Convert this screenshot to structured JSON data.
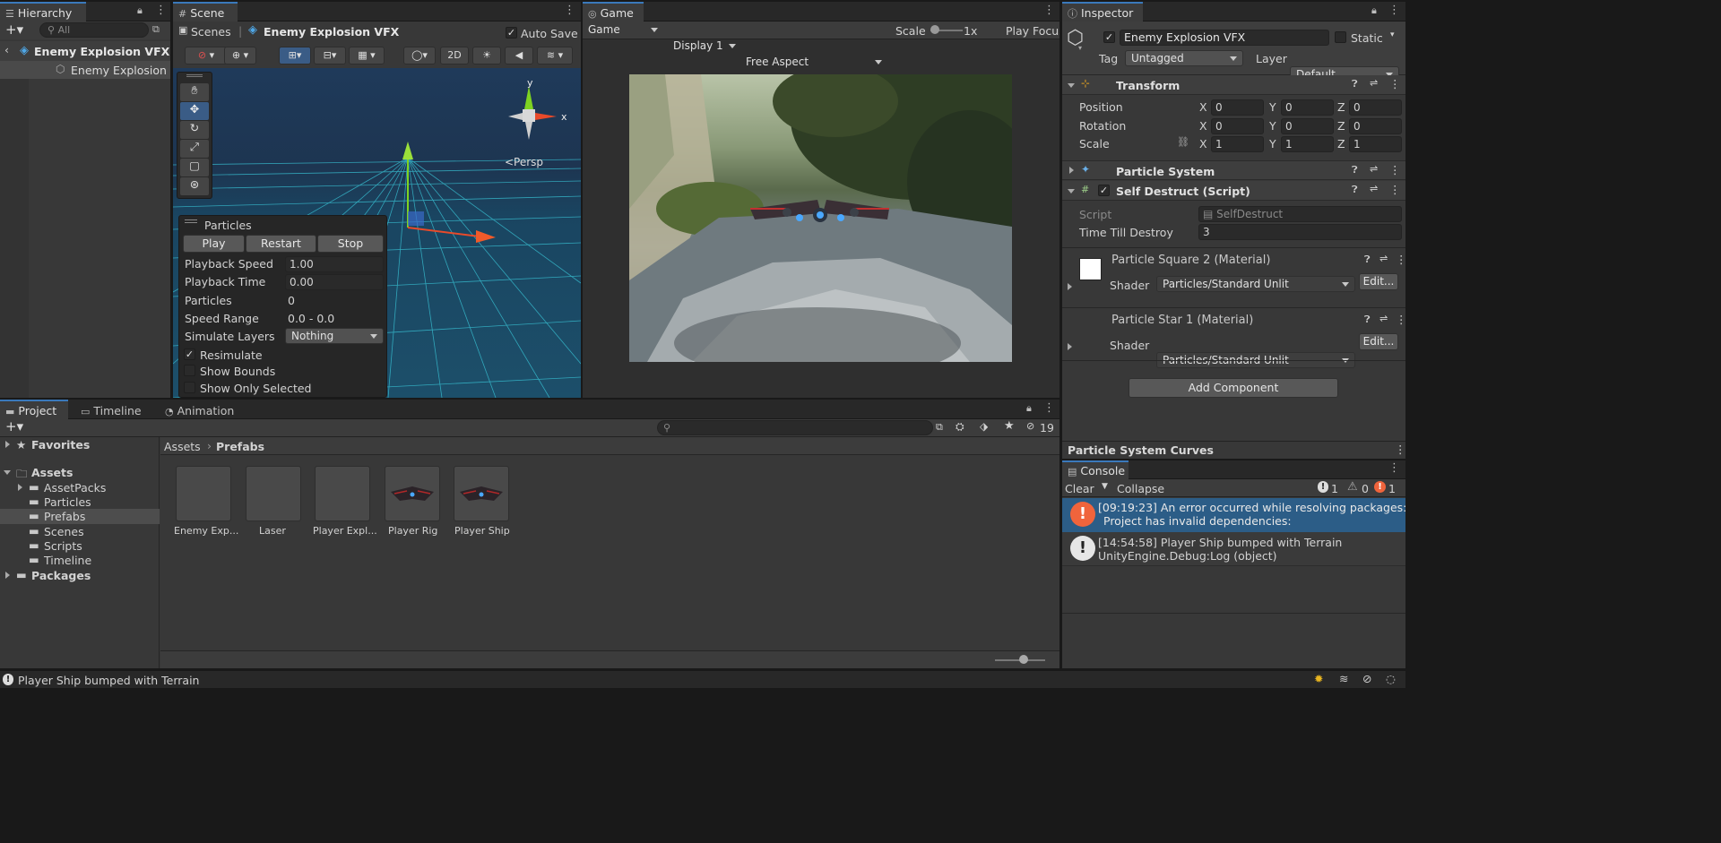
{
  "hierarchy": {
    "tab": "Hierarchy",
    "search_placeholder": "All",
    "scene_name": "Enemy Explosion VFX",
    "child_name": "Enemy Explosion V"
  },
  "scene": {
    "tab": "Scene",
    "breadcrumb_root": "Scenes",
    "breadcrumb_prefab": "Enemy Explosion VFX",
    "auto_save_label": "Auto Save",
    "auto_save_checked": true,
    "btn_2d": "2D",
    "gizmo_x": "x",
    "gizmo_y": "y",
    "persp_label": "<Persp",
    "particles": {
      "title": "Particles",
      "play": "Play",
      "restart": "Restart",
      "stop": "Stop",
      "playback_speed_label": "Playback Speed",
      "playback_speed": "1.00",
      "playback_time_label": "Playback Time",
      "playback_time": "0.00",
      "particles_label": "Particles",
      "particles_count": "0",
      "speed_range_label": "Speed Range",
      "speed_range": "0.0 - 0.0",
      "simulate_layers_label": "Simulate Layers",
      "simulate_layers": "Nothing",
      "resimulate": "Resimulate",
      "show_bounds": "Show Bounds",
      "show_only_selected": "Show Only Selected"
    }
  },
  "game": {
    "tab": "Game",
    "mode": "Game",
    "display": "Display 1",
    "aspect": "Free Aspect",
    "scale_label": "Scale",
    "scale_value": "1x",
    "play_focus": "Play Focus"
  },
  "inspector": {
    "tab": "Inspector",
    "object_name": "Enemy Explosion VFX",
    "static_label": "Static",
    "tag_label": "Tag",
    "tag_value": "Untagged",
    "layer_label": "Layer",
    "layer_value": "Default",
    "transform": {
      "title": "Transform",
      "position_label": "Position",
      "rotation_label": "Rotation",
      "scale_label": "Scale",
      "position": [
        "0",
        "0",
        "0"
      ],
      "rotation": [
        "0",
        "0",
        "0"
      ],
      "scale": [
        "1",
        "1",
        "1"
      ],
      "axis_x": "X",
      "axis_y": "Y",
      "axis_z": "Z"
    },
    "particle_system_title": "Particle System",
    "self_destruct": {
      "title": "Self Destruct (Script)",
      "script_label": "Script",
      "script_value": "SelfDestruct",
      "time_label": "Time Till Destroy",
      "time_value": "3"
    },
    "materials": [
      {
        "name": "Particle Square 2 (Material)",
        "shader_label": "Shader",
        "shader": "Particles/Standard Unlit",
        "edit": "Edit..."
      },
      {
        "name": "Particle Star 1 (Material)",
        "shader_label": "Shader",
        "shader": "Particles/Standard Unlit",
        "edit": "Edit..."
      }
    ],
    "add_component": "Add Component",
    "curves_title": "Particle System Curves"
  },
  "console": {
    "tab": "Console",
    "clear": "Clear",
    "collapse": "Collapse",
    "info_count": "1",
    "warn_count": "0",
    "error_count": "1",
    "entries": [
      {
        "time": "[09:19:23] An error occurred while resolving packages:",
        "line2": "Project has invalid dependencies:",
        "type": "error"
      },
      {
        "time": "[14:54:58] Player Ship bumped with Terrain",
        "line2": "UnityEngine.Debug:Log (object)",
        "type": "info"
      }
    ]
  },
  "project": {
    "tabs": [
      "Project",
      "Timeline",
      "Animation"
    ],
    "hidden_count": "19",
    "favorites": "Favorites",
    "assets": "Assets",
    "packages": "Packages",
    "folders": [
      "AssetPacks",
      "Particles",
      "Prefabs",
      "Scenes",
      "Scripts",
      "Timeline"
    ],
    "breadcrumb_root": "Assets",
    "breadcrumb_current": "Prefabs",
    "items": [
      "Enemy Exp...",
      "Laser",
      "Player Expl...",
      "Player Rig",
      "Player Ship"
    ]
  },
  "status_bar": {
    "message": "Player Ship bumped with Terrain"
  },
  "colors": {
    "accent": "#3a79bb",
    "selection": "#2c5d87",
    "panel": "#383838",
    "error": "#f0643c"
  }
}
